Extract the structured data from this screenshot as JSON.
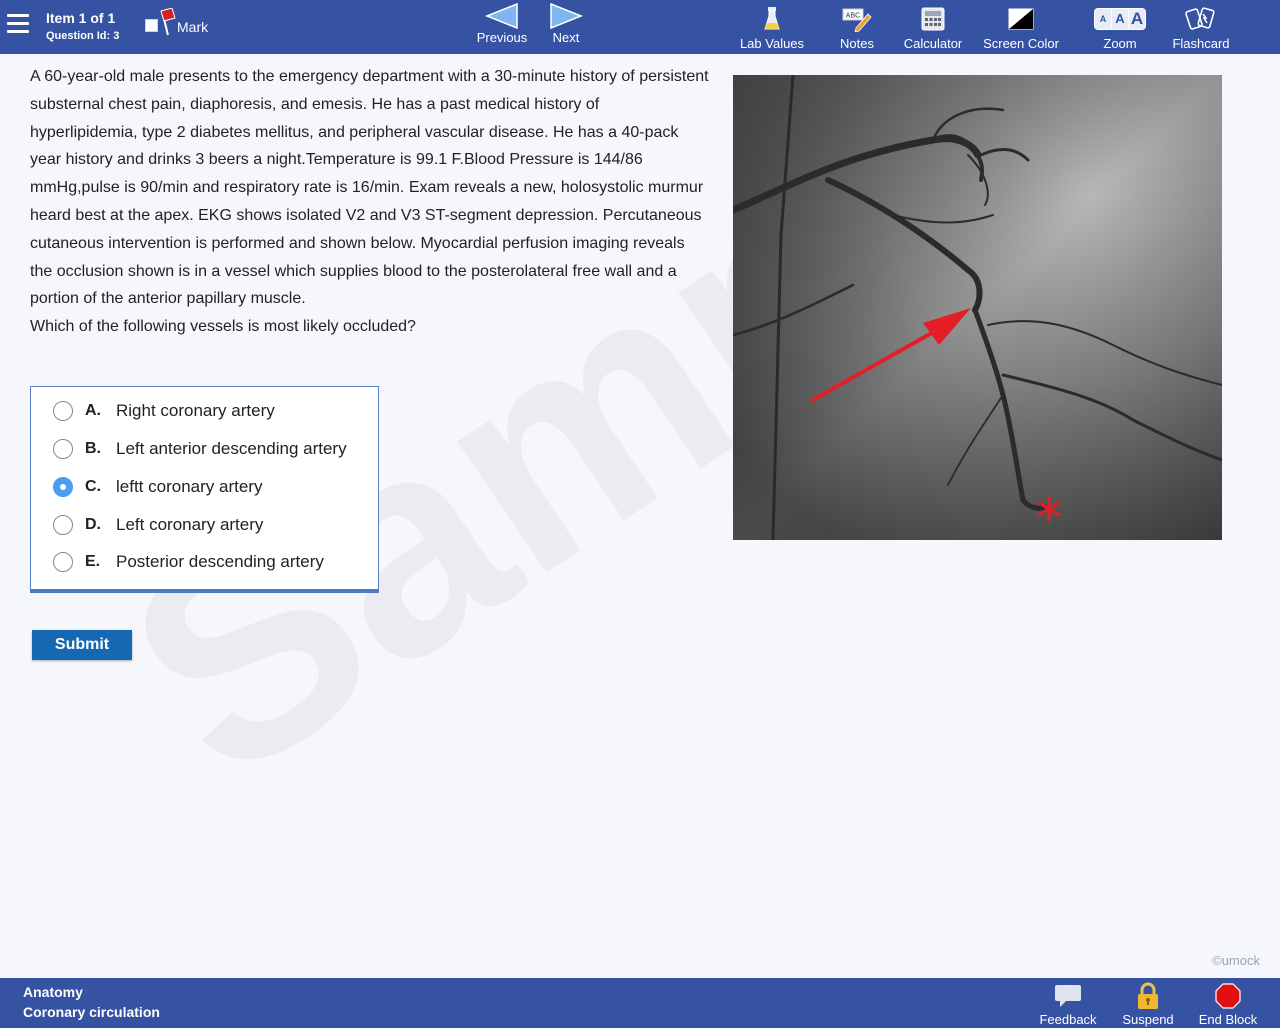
{
  "header": {
    "item_title": "Item 1 of 1",
    "question_id": "Question Id: 3",
    "mark_label": "Mark",
    "previous_label": "Previous",
    "next_label": "Next",
    "tools": {
      "lab_values": "Lab Values",
      "notes": "Notes",
      "notes_icon_text": "ABC",
      "calculator": "Calculator",
      "screen_color": "Screen Color",
      "zoom": "Zoom",
      "zoom_letters": [
        "A",
        "A",
        "A"
      ],
      "flashcard": "Flashcard"
    }
  },
  "question": {
    "stem": "A 60-year-old male presents to the emergency department with a 30-minute history of persistent substernal chest pain, diaphoresis, and emesis. He has a past medical history of hyperlipidemia, type 2 diabetes mellitus, and peripheral vascular disease. He has a 40-pack year history and drinks 3 beers a night.Temperature is 99.1 F.Blood Pressure is 144/86 mmHg,pulse is 90/min and respiratory rate is 16/min. Exam reveals a new, holosystolic murmur heard best at the apex. EKG shows isolated V2 and V3 ST-segment depression. Percutaneous cutaneous intervention is performed and shown below. Myocardial perfusion imaging reveals the occlusion shown is in a vessel which supplies blood to the posterolateral free wall and a portion of the anterior papillary muscle.",
    "prompt": "Which of the following vessels is most likely occluded?",
    "choices": [
      {
        "letter": "A.",
        "text": "Right coronary artery",
        "selected": false
      },
      {
        "letter": "B.",
        "text": "Left anterior descending artery",
        "selected": false
      },
      {
        "letter": "C.",
        "text": "leftt coronary artery",
        "selected": true
      },
      {
        "letter": "D.",
        "text": "Left coronary artery",
        "selected": false
      },
      {
        "letter": "E.",
        "text": "Posterior descending artery",
        "selected": false
      }
    ],
    "submit_label": "Submit"
  },
  "watermark": "Sample",
  "copyright": "©umock",
  "footer": {
    "subject": "Anatomy",
    "topic": "Coronary circulation",
    "feedback": "Feedback",
    "suspend": "Suspend",
    "end_block": "End Block"
  },
  "colors": {
    "bar_bg": "#3652a3",
    "submit_bg": "#1668b3",
    "selected_radio": "#4c9cf0",
    "arrow_red": "#e41e26",
    "end_block_red": "#e01010"
  }
}
